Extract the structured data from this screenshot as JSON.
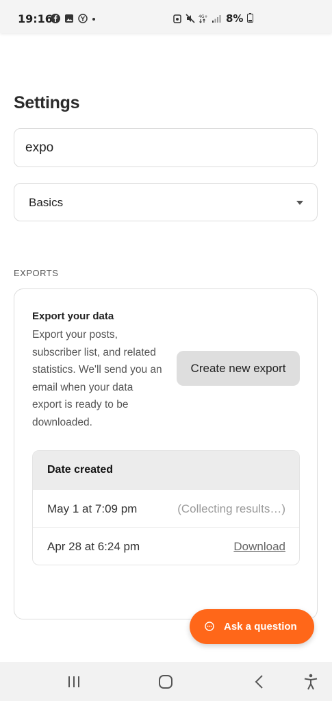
{
  "status_bar": {
    "time": "19:16",
    "battery": "8%",
    "left_icons": [
      "facebook-icon",
      "gallery-icon",
      "app-icon"
    ],
    "right_icons": [
      "alarm-icon",
      "mute-icon",
      "network-4g-icon",
      "signal-icon"
    ]
  },
  "page": {
    "title": "Settings"
  },
  "search": {
    "value": "expo"
  },
  "category_select": {
    "value": "Basics"
  },
  "exports_section": {
    "label": "EXPORTS",
    "card_title": "Export your data",
    "card_description": "Export your posts, subscriber list, and related statistics. We'll send you an email when your data export is ready to be downloaded.",
    "create_button_label": "Create new export",
    "table": {
      "header": "Date created",
      "rows": [
        {
          "date": "May 1 at 7:09 pm",
          "status": "(Collecting results…)"
        },
        {
          "date": "Apr 28 at 6:24 pm",
          "action": "Download"
        }
      ]
    }
  },
  "chat": {
    "label": "Ask a question",
    "accent": "#ff6719"
  },
  "nav_bar": {
    "items": [
      "recent-apps-icon",
      "home-icon",
      "back-icon",
      "accessibility-icon"
    ]
  }
}
